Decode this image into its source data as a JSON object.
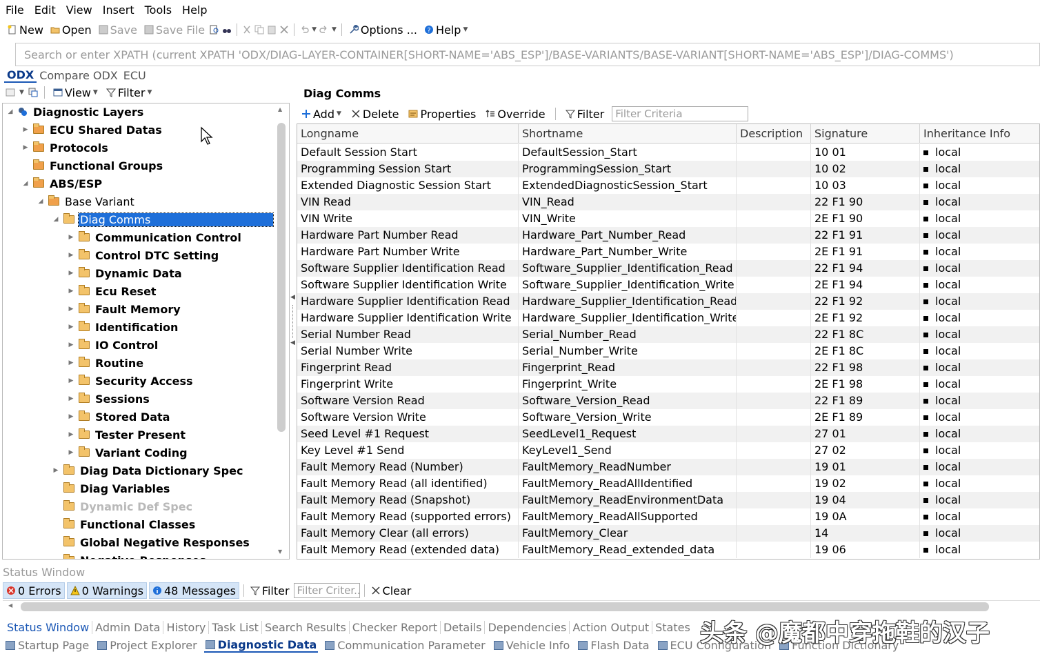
{
  "menu": [
    "File",
    "Edit",
    "View",
    "Insert",
    "Tools",
    "Help"
  ],
  "toolbar": {
    "new": "New",
    "open": "Open",
    "save": "Save",
    "save_file": "Save File",
    "options": "Options ...",
    "help": "Help"
  },
  "xpath_placeholder": "Search or enter XPATH (current XPATH 'ODX/DIAG-LAYER-CONTAINER[SHORT-NAME='ABS_ESP']/BASE-VARIANTS/BASE-VARIANT[SHORT-NAME='ABS_ESP']/DIAG-COMMS')",
  "left_tabs": [
    "ODX",
    "Compare ODX",
    "ECU"
  ],
  "left_toolbar": {
    "view": "View",
    "filter": "Filter"
  },
  "tree": [
    "Diagnostic Layers",
    "ECU Shared Datas",
    "Protocols",
    "Functional Groups",
    "ABS/ESP",
    "Base Variant",
    "Diag Comms",
    "Communication Control",
    "Control DTC Setting",
    "Dynamic Data",
    "Ecu Reset",
    "Fault Memory",
    "Identification",
    "IO Control",
    "Routine",
    "Security Access",
    "Sessions",
    "Stored Data",
    "Tester Present",
    "Variant Coding",
    "Diag Data Dictionary Spec",
    "Diag Variables",
    "Dynamic Def Spec",
    "Functional Classes",
    "Global Negative Responses",
    "Negative Responses"
  ],
  "right": {
    "title": "Diag Comms",
    "add": "Add",
    "delete": "Delete",
    "properties": "Properties",
    "override": "Override",
    "filter": "Filter",
    "filter_placeholder": "Filter Criteria",
    "columns": [
      "Longname",
      "Shortname",
      "Description",
      "Signature",
      "Inheritance Info"
    ]
  },
  "rows": [
    [
      "Default Session Start",
      "DefaultSession_Start",
      "",
      "10 01",
      "local"
    ],
    [
      "Programming Session Start",
      "ProgrammingSession_Start",
      "",
      "10 02",
      "local"
    ],
    [
      "Extended Diagnostic Session Start",
      "ExtendedDiagnosticSession_Start",
      "",
      "10 03",
      "local"
    ],
    [
      "VIN Read",
      "VIN_Read",
      "",
      "22 F1 90",
      "local"
    ],
    [
      "VIN Write",
      "VIN_Write",
      "",
      "2E F1 90",
      "local"
    ],
    [
      "Hardware Part Number Read",
      "Hardware_Part_Number_Read",
      "",
      "22 F1 91",
      "local"
    ],
    [
      "Hardware Part Number Write",
      "Hardware_Part_Number_Write",
      "",
      "2E F1 91",
      "local"
    ],
    [
      "Software Supplier Identification Read",
      "Software_Supplier_Identification_Read",
      "",
      "22 F1 94",
      "local"
    ],
    [
      "Software Supplier Identification Write",
      "Software_Supplier_Identification_Write",
      "",
      "2E F1 94",
      "local"
    ],
    [
      "Hardware Supplier Identification Read",
      "Hardware_Supplier_Identification_Read",
      "",
      "22 F1 92",
      "local"
    ],
    [
      "Hardware Supplier Identification Write",
      "Hardware_Supplier_Identification_Write",
      "",
      "2E F1 92",
      "local"
    ],
    [
      "Serial Number Read",
      "Serial_Number_Read",
      "",
      "22 F1 8C",
      "local"
    ],
    [
      "Serial Number Write",
      "Serial_Number_Write",
      "",
      "2E F1 8C",
      "local"
    ],
    [
      "Fingerprint Read",
      "Fingerprint_Read",
      "",
      "22 F1 98",
      "local"
    ],
    [
      "Fingerprint Write",
      "Fingerprint_Write",
      "",
      "2E F1 98",
      "local"
    ],
    [
      "Software Version Read",
      "Software_Version_Read",
      "",
      "22 F1 89",
      "local"
    ],
    [
      "Software Version Write",
      "Software_Version_Write",
      "",
      "2E F1 89",
      "local"
    ],
    [
      "Seed Level #1 Request",
      "SeedLevel1_Request",
      "",
      "27 01",
      "local"
    ],
    [
      "Key Level #1 Send",
      "KeyLevel1_Send",
      "",
      "27 02",
      "local"
    ],
    [
      "Fault Memory Read (Number)",
      "FaultMemory_ReadNumber",
      "",
      "19 01",
      "local"
    ],
    [
      "Fault Memory Read (all identified)",
      "FaultMemory_ReadAllIdentified",
      "",
      "19 02",
      "local"
    ],
    [
      "Fault Memory Read (Snapshot)",
      "FaultMemory_ReadEnvironmentData",
      "",
      "19 04",
      "local"
    ],
    [
      "Fault Memory Read (supported errors)",
      "FaultMemory_ReadAllSupported",
      "",
      "19 0A",
      "local"
    ],
    [
      "Fault Memory Clear (all errors)",
      "FaultMemory_Clear",
      "",
      "14",
      "local"
    ],
    [
      "Fault Memory Read (extended data)",
      "FaultMemory_Read_extended_data",
      "",
      "19 06",
      "local"
    ]
  ],
  "status": {
    "title": "Status Window",
    "errors": "0 Errors",
    "warnings": "0 Warnings",
    "messages": "48 Messages",
    "filter": "Filter",
    "filter_placeholder": "Filter Criter...",
    "clear": "Clear"
  },
  "bottom_tabs": [
    "Status Window",
    "Admin Data",
    "History",
    "Task List",
    "Search Results",
    "Checker Report",
    "Details",
    "Dependencies",
    "Action Output",
    "States"
  ],
  "nav_tabs": [
    "Startup Page",
    "Project Explorer",
    "Diagnostic Data",
    "Communication Parameter",
    "Vehicle Info",
    "Flash Data",
    "ECU Configuration",
    "Function Dictionary"
  ],
  "watermark": "头条 @魔都中穿拖鞋的汉子"
}
